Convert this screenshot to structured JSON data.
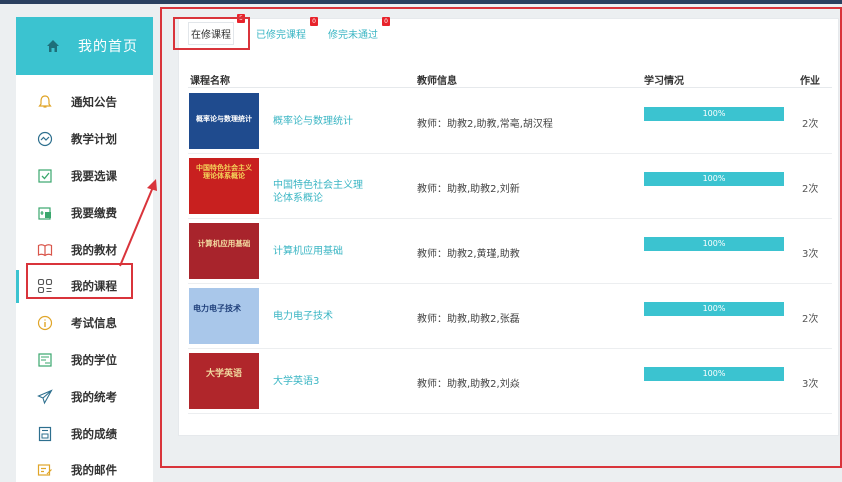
{
  "sidebar": {
    "home_label": "我的首页",
    "items": [
      {
        "label": "通知公告",
        "icon": "bell-icon"
      },
      {
        "label": "教学计划",
        "icon": "chart-wave-icon"
      },
      {
        "label": "我要选课",
        "icon": "checkbox-icon"
      },
      {
        "label": "我要缴费",
        "icon": "payment-icon"
      },
      {
        "label": "我的教材",
        "icon": "book-icon"
      },
      {
        "label": "我的课程",
        "icon": "grid-icon"
      },
      {
        "label": "考试信息",
        "icon": "info-icon"
      },
      {
        "label": "我的学位",
        "icon": "degree-icon"
      },
      {
        "label": "我的统考",
        "icon": "paper-plane-icon"
      },
      {
        "label": "我的成绩",
        "icon": "report-icon"
      },
      {
        "label": "我的邮件",
        "icon": "mail-edit-icon"
      }
    ]
  },
  "tabs": [
    {
      "label": "在修课程",
      "badge": "5"
    },
    {
      "label": "已修完课程",
      "badge": "0"
    },
    {
      "label": "修完未通过",
      "badge": "0"
    }
  ],
  "table": {
    "headers": {
      "name": "课程名称",
      "teacher": "教师信息",
      "progress": "学习情况",
      "homework": "作业"
    },
    "rows": [
      {
        "cover_text": "概率论与数理统计",
        "name": "概率论与数理统计",
        "teacher": "教师：助教2,助教,常亳,胡汉程",
        "progress": "100%",
        "progress_value": 100,
        "homework": "2次"
      },
      {
        "cover_text": "中国特色社会主义理论体系概论",
        "name": "中国特色社会主义理论体系概论",
        "teacher": "教师：助教,助教2,刘新",
        "progress": "100%",
        "progress_value": 100,
        "homework": "2次"
      },
      {
        "cover_text": "计算机应用基础",
        "name": "计算机应用基础",
        "teacher": "教师：助教2,黄瑾,助教",
        "progress": "100%",
        "progress_value": 100,
        "homework": "3次"
      },
      {
        "cover_text": "电力电子技术",
        "name": "电力电子技术",
        "teacher": "教师：助教,助教2,张磊",
        "progress": "100%",
        "progress_value": 100,
        "homework": "2次"
      },
      {
        "cover_text": "大学英语",
        "name": "大学英语3",
        "teacher": "教师：助教,助教2,刘焱",
        "progress": "100%",
        "progress_value": 100,
        "homework": "3次"
      }
    ]
  },
  "colors": {
    "accent": "#3bc3d0",
    "highlight": "#d9343b",
    "badge": "#e8232b"
  }
}
